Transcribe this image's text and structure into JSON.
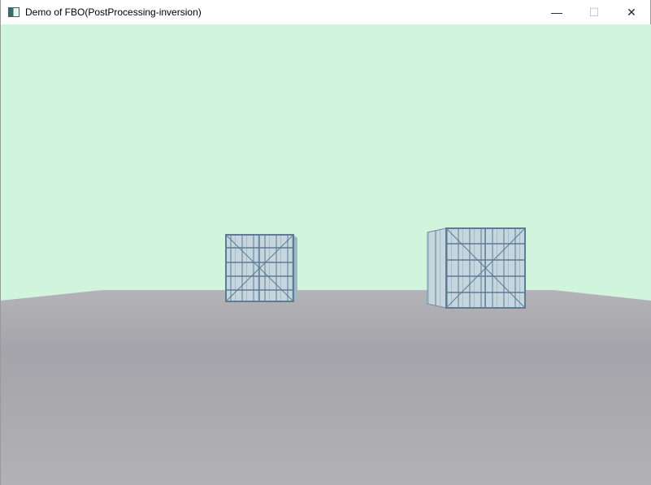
{
  "window": {
    "title": "Demo of FBO(PostProcessing-inversion)",
    "minimize_label": "—",
    "maximize_label": "☐",
    "close_label": "✕"
  },
  "scene": {
    "sky_color": "#d1f4dc",
    "floor_color": "#a9a9ae",
    "crate_color": "#b9cdd8"
  }
}
